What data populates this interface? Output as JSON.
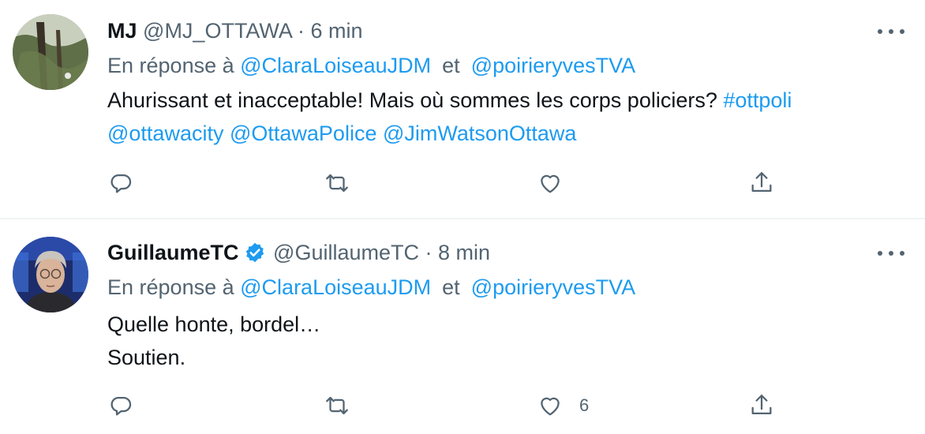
{
  "tweets": [
    {
      "name": "MJ",
      "handle": "@MJ_OTTAWA",
      "separator": "·",
      "time": "6 min",
      "verified": false,
      "reply_prefix": "En réponse à",
      "reply_to": [
        "@ClaraLoiseauJDM",
        "@poirieryvesTVA"
      ],
      "reply_joiner": "et",
      "body_line1_text": "Ahurissant et inacceptable! Mais où sommes les corps policiers? ",
      "body_line1_hashtag": "#ottpoli",
      "body_line2_mentions": [
        "@ottawacity",
        "@OttawaPolice",
        "@JimWatsonOttawa"
      ],
      "like_count": ""
    },
    {
      "name": "GuillaumeTC",
      "handle": "@GuillaumeTC",
      "separator": "·",
      "time": "8 min",
      "verified": true,
      "reply_prefix": "En réponse à",
      "reply_to": [
        "@ClaraLoiseauJDM",
        "@poirieryvesTVA"
      ],
      "reply_joiner": "et",
      "body_lines": [
        "Quelle honte, bordel…",
        "Soutien."
      ],
      "like_count": "6"
    }
  ],
  "colors": {
    "text": "#0f1419",
    "secondary": "#536471",
    "accent": "#1d9bf0",
    "divider": "#eff3f4"
  },
  "icons": {
    "reply": "reply-icon",
    "retweet": "retweet-icon",
    "like": "heart-icon",
    "share": "share-icon",
    "more": "more-icon",
    "verified": "verified-badge-icon"
  }
}
